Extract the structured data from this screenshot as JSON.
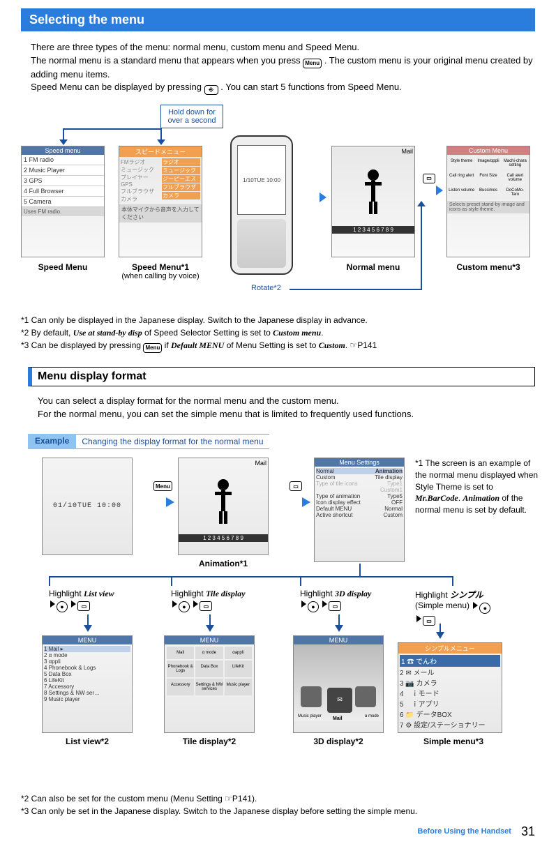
{
  "title": "Selecting the menu",
  "intro": {
    "line1": "There are three types of the menu: normal menu, custom menu and Speed Menu.",
    "line2a": "The normal menu is a standard menu that appears when you press ",
    "line2b": ". The custom menu is your original menu created by adding menu items.",
    "line3a": "Speed Menu can be displayed by pressing ",
    "line3b": ". You can start 5 functions from Speed Menu.",
    "menu_icon": "Menu",
    "speed_icon": "⎆"
  },
  "diagram": {
    "hold_note": "Hold down for over a second",
    "rotate_note": "Rotate*2",
    "speed_menu": {
      "title": "Speed menu",
      "items": [
        "FM radio",
        "Music Player",
        "GPS",
        "Full Browser",
        "Camera"
      ],
      "foot": "Uses FM radio.",
      "caption": "Speed Menu"
    },
    "speed_menu_jp": {
      "title": "スピードメニュー",
      "left": [
        "FMラジオ",
        "ミュージックプレイヤー",
        "GPS",
        "フルブラウザ",
        "カメラ"
      ],
      "right": [
        "ラジオ",
        "ミュージック",
        "ジーピーエス",
        "フルブラウザ",
        "カメラ"
      ],
      "foot": "本体マイクから音声を入力してください",
      "caption": "Speed Menu*1",
      "caption_sub": "(when calling by voice)"
    },
    "phone_screen": "1/10TUE 10:00",
    "normal_menu": {
      "label_mail": "Mail",
      "numbers": "1 2 3 4 5 6 7 8 9",
      "caption": "Normal menu"
    },
    "custom_menu": {
      "title": "Custom Menu",
      "grid": [
        "Style theme",
        "Image/αppli",
        "Machi-chara setting",
        "Call ring alert",
        "Font Size",
        "Call alert volume",
        "Listen volume",
        "Bussimos",
        "DoCoMo-Taro"
      ],
      "foot": "Selects preset stand-by image and icons as style theme.",
      "caption": "Custom menu*3"
    },
    "book_icon": "⌘"
  },
  "footnotes1": {
    "n1": "*1 Can only be displayed in the Japanese display. Switch to the Japanese display in advance.",
    "n2a": "*2 By default, ",
    "n2_it1": "Use at stand-by disp",
    "n2b": " of Speed Selector Setting is set to ",
    "n2_it2": "Custom menu",
    "n2c": ".",
    "n3a": "*3 Can be displayed by pressing ",
    "n3b": " if ",
    "n3_it1": "Default MENU",
    "n3c": " of Menu Setting is set to ",
    "n3_it2": "Custom",
    "n3d": ". ",
    "n3_ref": "P141",
    "menu_icon": "Menu"
  },
  "subsection": "Menu display format",
  "sub_intro": {
    "line1": "You can select a display format for the normal menu and the custom menu.",
    "line2": "For the normal menu, you can set the simple menu that is limited to frequently used functions."
  },
  "example": {
    "tag": "Example",
    "text": "Changing the display format for the normal menu"
  },
  "format": {
    "standby_time": "01/10TUE 10:00",
    "menu_icon": "Menu",
    "book_icon": "⌘",
    "animation": {
      "label_mail": "Mail",
      "numbers": "1 2 3 4 5 6 7 8 9",
      "caption": "Animation*1"
    },
    "menu_settings": {
      "title": "Menu Settings",
      "rows": [
        [
          "Normal",
          "Animation"
        ],
        [
          "Custom",
          "Tile display"
        ],
        [
          "Type of tile icons",
          "Type1"
        ],
        [
          "",
          "Custom1"
        ],
        [
          "Type of animation",
          "Type5"
        ],
        [
          "Icon display effect",
          "OFF"
        ],
        [
          "Default MENU",
          "Normal"
        ],
        [
          "Active shortcut",
          "Custom"
        ]
      ]
    },
    "side_note": {
      "pre": "*1 The screen is an example of the normal menu displayed when Style Theme is set to ",
      "it1": "Mr.BarCode",
      "mid": ". ",
      "it2": "Animation",
      "post": " of the normal menu is set by default."
    },
    "highlights": {
      "list": "List view",
      "tile": "Tile display",
      "threed": "3D display",
      "simple_jp": "シンプル",
      "simple_sub": "(Simple menu)",
      "highlight_word": "Highlight "
    },
    "list_view": {
      "title": "MENU",
      "items": [
        "Mail",
        "α mode",
        "αppli",
        "Phonebook & Logs",
        "Data Box",
        "LifeKit",
        "Accessory",
        "Settings & NW ser…",
        "Music player"
      ],
      "caption": "List view*2"
    },
    "tile_display": {
      "title": "MENU",
      "grid": [
        "Mail",
        "α mode",
        "αappli",
        "Phonebook & Logs",
        "Data Box",
        "LifeKit",
        "Accessory",
        "Settings & NW services",
        "Music player"
      ],
      "caption": "Tile display*2"
    },
    "threed_display": {
      "title": "MENU",
      "labels": [
        "Music player",
        "Mail",
        "α mode"
      ],
      "caption": "3D display*2"
    },
    "simple_menu": {
      "title": "シンプルメニュー",
      "items": [
        "でんわ",
        "メール",
        "カメラ",
        "ｉモード",
        "ｉアプリ",
        "データBOX",
        "設定/ステーショナリー"
      ],
      "caption": "Simple menu*3"
    }
  },
  "footnotes2": {
    "n2a": "*2 Can also be set for the custom menu (Menu Setting ",
    "n2_ref": "P141).",
    "n3": "*3 Can only be set in the Japanese display. Switch to the Japanese display before setting the simple menu."
  },
  "footer": {
    "section": "Before Using the Handset",
    "page": "31"
  }
}
